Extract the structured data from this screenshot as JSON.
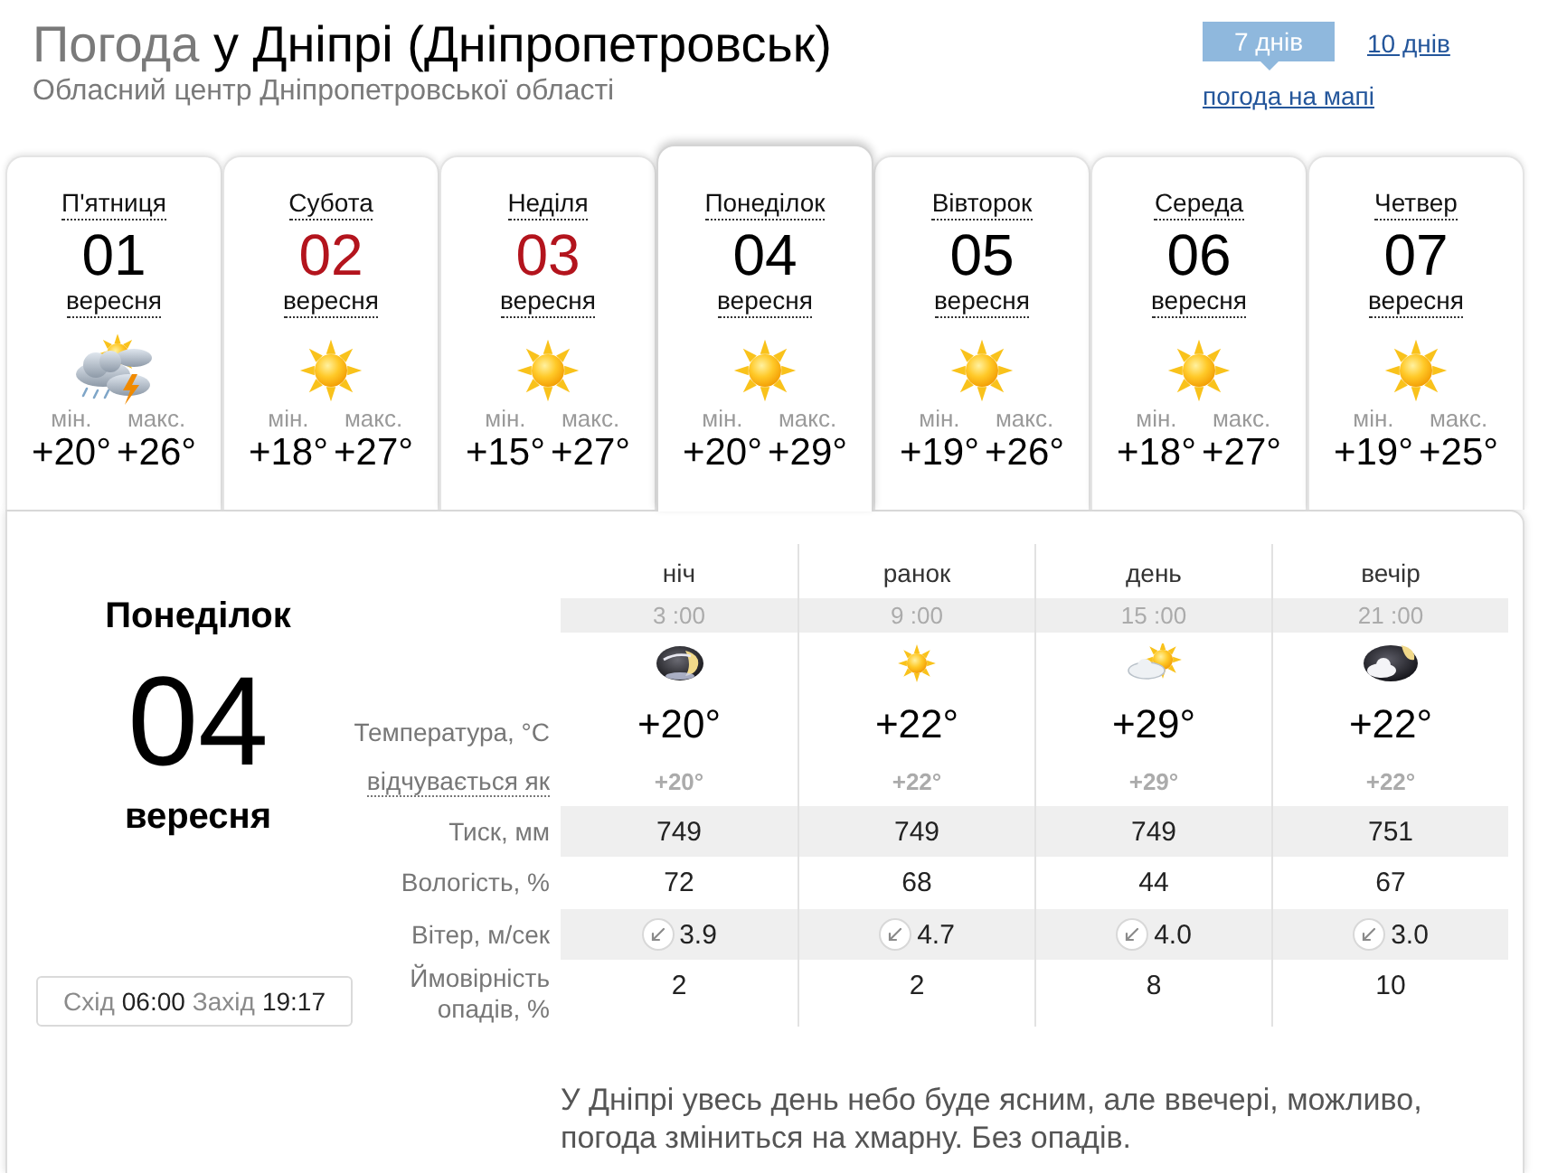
{
  "header": {
    "title_prefix": "Погода",
    "title": "у Дніпрі (Дніпропетровськ)",
    "subtitle": "Обласний центр Дніпропетровської області"
  },
  "range_tabs": [
    {
      "label": "7 днів",
      "selected": true
    },
    {
      "label": "10 днів",
      "selected": false
    }
  ],
  "map_link": "погода на мапі",
  "days": [
    {
      "weekday": "П'ятниця",
      "date": "01",
      "month": "вересня",
      "weekend": false,
      "kind": "storm",
      "min_label": "мін.",
      "min": "+20°",
      "max_label": "макс.",
      "max": "+26°",
      "selected": false
    },
    {
      "weekday": "Субота",
      "date": "02",
      "month": "вересня",
      "weekend": true,
      "kind": "sun",
      "min_label": "мін.",
      "min": "+18°",
      "max_label": "макс.",
      "max": "+27°",
      "selected": false
    },
    {
      "weekday": "Неділя",
      "date": "03",
      "month": "вересня",
      "weekend": true,
      "kind": "sun",
      "min_label": "мін.",
      "min": "+15°",
      "max_label": "макс.",
      "max": "+27°",
      "selected": false
    },
    {
      "weekday": "Понеділок",
      "date": "04",
      "month": "вересня",
      "weekend": false,
      "kind": "sun",
      "min_label": "мін.",
      "min": "+20°",
      "max_label": "макс.",
      "max": "+29°",
      "selected": true
    },
    {
      "weekday": "Вівторок",
      "date": "05",
      "month": "вересня",
      "weekend": false,
      "kind": "sun",
      "min_label": "мін.",
      "min": "+19°",
      "max_label": "макс.",
      "max": "+26°",
      "selected": false
    },
    {
      "weekday": "Середа",
      "date": "06",
      "month": "вересня",
      "weekend": false,
      "kind": "sun",
      "min_label": "мін.",
      "min": "+18°",
      "max_label": "макс.",
      "max": "+27°",
      "selected": false
    },
    {
      "weekday": "Четвер",
      "date": "07",
      "month": "вересня",
      "weekend": false,
      "kind": "sun",
      "min_label": "мін.",
      "min": "+19°",
      "max_label": "макс.",
      "max": "+25°",
      "selected": false
    }
  ],
  "detail": {
    "weekday": "Понеділок",
    "date": "04",
    "month": "вересня",
    "sunrise_label": "Схід",
    "sunrise": "06:00",
    "sunset_label": "Захід",
    "sunset": "19:17"
  },
  "row_labels": {
    "temperature": "Температура, °C",
    "feels_like": "відчувається як",
    "pressure": "Тиск, мм",
    "humidity": "Вологість, %",
    "wind": "Вітер, м/сек",
    "precipitation": "Ймовірність опадів, %"
  },
  "periods": [
    {
      "name": "ніч",
      "time": "3 :00",
      "kind": "night",
      "temperature": "+20°",
      "feels_like": "+20°",
      "pressure": "749",
      "humidity": "72",
      "wind": "3.9",
      "precipitation": "2"
    },
    {
      "name": "ранок",
      "time": "9 :00",
      "kind": "sun",
      "temperature": "+22°",
      "feels_like": "+22°",
      "pressure": "749",
      "humidity": "68",
      "wind": "4.7",
      "precipitation": "2"
    },
    {
      "name": "день",
      "time": "15 :00",
      "kind": "cloudy",
      "temperature": "+29°",
      "feels_like": "+29°",
      "pressure": "749",
      "humidity": "44",
      "wind": "4.0",
      "precipitation": "8"
    },
    {
      "name": "вечір",
      "time": "21 :00",
      "kind": "evening",
      "temperature": "+22°",
      "feels_like": "+22°",
      "pressure": "751",
      "humidity": "67",
      "wind": "3.0",
      "precipitation": "10"
    }
  ],
  "description": "У Дніпрі увесь день небо буде ясним, але ввечері, можливо, погода зміниться на хмарну. Без опадів."
}
